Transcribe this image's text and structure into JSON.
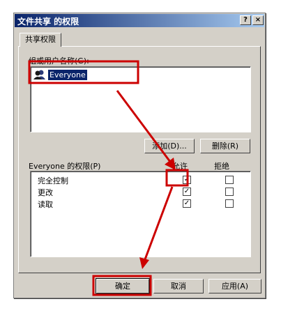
{
  "window": {
    "title": "文件共享 的权限",
    "help_button": "?",
    "close_button": "×"
  },
  "tabs": [
    {
      "label": "共享权限"
    }
  ],
  "users": {
    "label": "组或用户名称(G):",
    "items": [
      {
        "name": "Everyone",
        "icon": "user-group-icon",
        "selected": true
      }
    ]
  },
  "buttons": {
    "add": "添加(D)...",
    "remove": "删除(R)",
    "ok": "确定",
    "cancel": "取消",
    "apply": "应用(A)"
  },
  "permissions": {
    "label": "Everyone 的权限(P)",
    "allow_header": "允许",
    "deny_header": "拒绝",
    "rows": [
      {
        "name": "完全控制",
        "allow": true,
        "deny": false
      },
      {
        "name": "更改",
        "allow": true,
        "deny": false
      },
      {
        "name": "读取",
        "allow": true,
        "deny": false
      }
    ]
  },
  "colors": {
    "annotation": "#cc0000",
    "titlebar_start": "#0a246a",
    "titlebar_end": "#a6caf0",
    "face": "#d4d0c8"
  }
}
